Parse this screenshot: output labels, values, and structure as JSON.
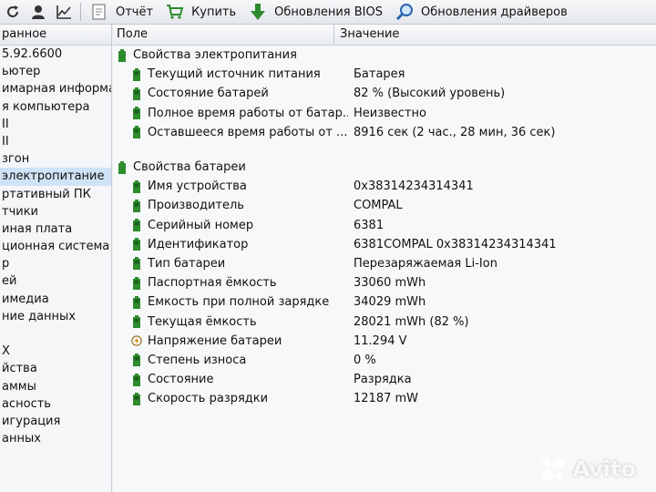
{
  "toolbar": {
    "report_label": "Отчёт",
    "buy_label": "Купить",
    "bios_label": "Обновления BIOS",
    "drivers_label": "Обновления драйверов"
  },
  "sidebar": {
    "header": "ранное",
    "items": [
      {
        "label": "5.92.6600",
        "selected": false
      },
      {
        "label": "ьютер",
        "selected": false
      },
      {
        "label": "имарная информа",
        "selected": false
      },
      {
        "label": "я компьютера",
        "selected": false
      },
      {
        "label": "II",
        "selected": false
      },
      {
        "label": "II",
        "selected": false
      },
      {
        "label": "згон",
        "selected": false
      },
      {
        "label": "электропитание",
        "selected": true
      },
      {
        "label": "ртативный ПК",
        "selected": false
      },
      {
        "label": "тчики",
        "selected": false
      },
      {
        "label": "иная плата",
        "selected": false
      },
      {
        "label": "ционная система",
        "selected": false
      },
      {
        "label": "р",
        "selected": false
      },
      {
        "label": "ей",
        "selected": false
      },
      {
        "label": "имедиа",
        "selected": false
      },
      {
        "label": "ние данных",
        "selected": false
      },
      {
        "label": "",
        "selected": false
      },
      {
        "label": "X",
        "selected": false
      },
      {
        "label": "йства",
        "selected": false
      },
      {
        "label": "аммы",
        "selected": false
      },
      {
        "label": "асность",
        "selected": false
      },
      {
        "label": "игурация",
        "selected": false
      },
      {
        "label": "анных",
        "selected": false
      }
    ]
  },
  "table": {
    "col_field": "Поле",
    "col_value": "Значение",
    "group1": {
      "title": "Свойства электропитания",
      "rows": [
        {
          "field": "Текущий источник питания",
          "value": "Батарея"
        },
        {
          "field": "Состояние батарей",
          "value": "82 % (Высокий уровень)"
        },
        {
          "field": "Полное время работы от батар...",
          "value": "Неизвестно"
        },
        {
          "field": "Оставшееся время работы от ...",
          "value": "8916 сек (2 час., 28 мин, 36 сек)"
        }
      ]
    },
    "group2": {
      "title": "Свойства батареи",
      "rows": [
        {
          "field": "Имя устройства",
          "value": "0x38314234314341",
          "icon": "battery"
        },
        {
          "field": "Производитель",
          "value": "COMPAL",
          "icon": "battery"
        },
        {
          "field": "Серийный номер",
          "value": "6381",
          "icon": "battery"
        },
        {
          "field": "Идентификатор",
          "value": "6381COMPAL 0x38314234314341",
          "icon": "battery"
        },
        {
          "field": "Тип батареи",
          "value": "Перезаряжаемая Li-Ion",
          "icon": "battery"
        },
        {
          "field": "Паспортная ёмкость",
          "value": "33060 mWh",
          "icon": "battery"
        },
        {
          "field": "Ёмкость при полной зарядке",
          "value": "34029 mWh",
          "icon": "battery"
        },
        {
          "field": "Текущая ёмкость",
          "value": "28021 mWh  (82 %)",
          "icon": "battery"
        },
        {
          "field": "Напряжение батареи",
          "value": "11.294 V",
          "icon": "voltage"
        },
        {
          "field": "Степень износа",
          "value": "0 %",
          "icon": "battery"
        },
        {
          "field": "Состояние",
          "value": "Разрядка",
          "icon": "battery"
        },
        {
          "field": "Скорость разрядки",
          "value": "12187 mW",
          "icon": "battery"
        }
      ]
    }
  },
  "watermark": {
    "text": "Avito"
  },
  "colors": {
    "accent_green": "#2e8b2e",
    "selection": "#cfe3f7"
  }
}
